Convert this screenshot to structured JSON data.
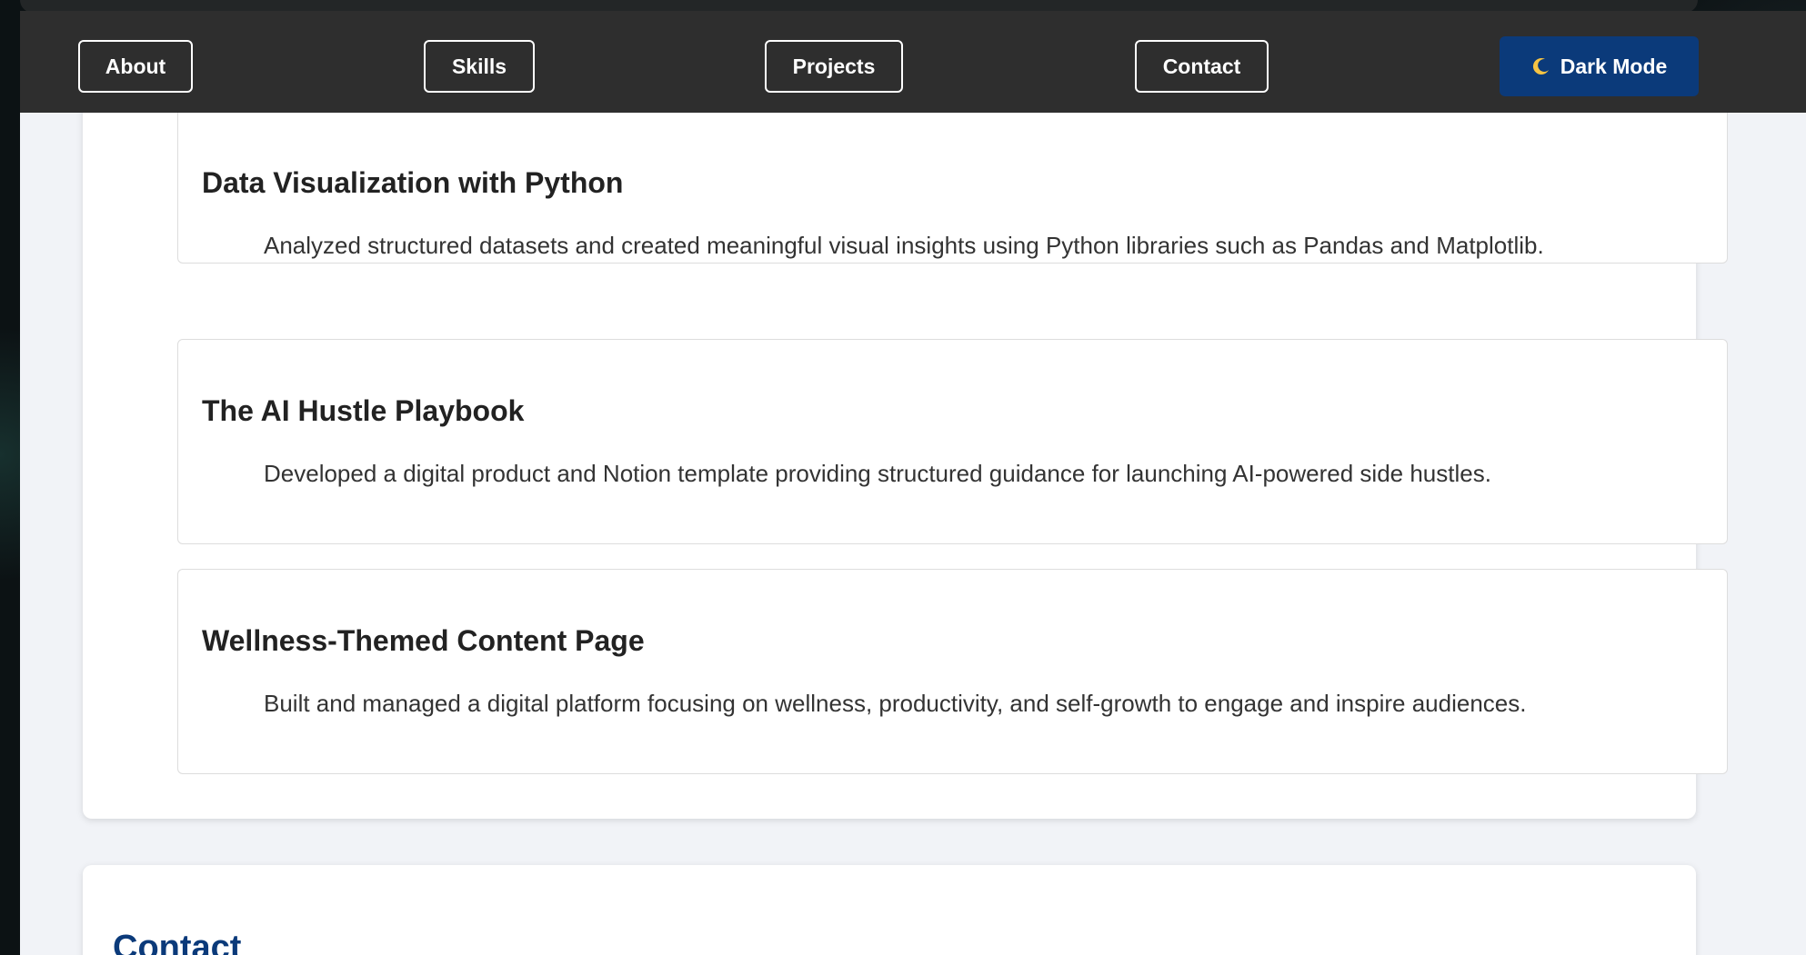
{
  "navbar": {
    "links": [
      "About",
      "Skills",
      "Projects",
      "Contact"
    ],
    "dark_mode": {
      "icon": "moon-icon",
      "label": "Dark Mode"
    }
  },
  "projects": [
    {
      "title": "Data Visualization with Python",
      "description": "Analyzed structured datasets and created meaningful visual insights using Python libraries such as Pandas and Matplotlib."
    },
    {
      "title": "The AI Hustle Playbook",
      "description": "Developed a digital product and Notion template providing structured guidance for launching AI-powered side hustles."
    },
    {
      "title": "Wellness-Themed Content Page",
      "description": "Built and managed a digital platform focusing on wellness, productivity, and self-growth to engage and inspire audiences."
    }
  ],
  "contact": {
    "heading": "Contact"
  },
  "colors": {
    "navbar_bg": "#2e2e2e",
    "accent": "#0b3a7a",
    "page_bg": "#f1f3f7"
  }
}
